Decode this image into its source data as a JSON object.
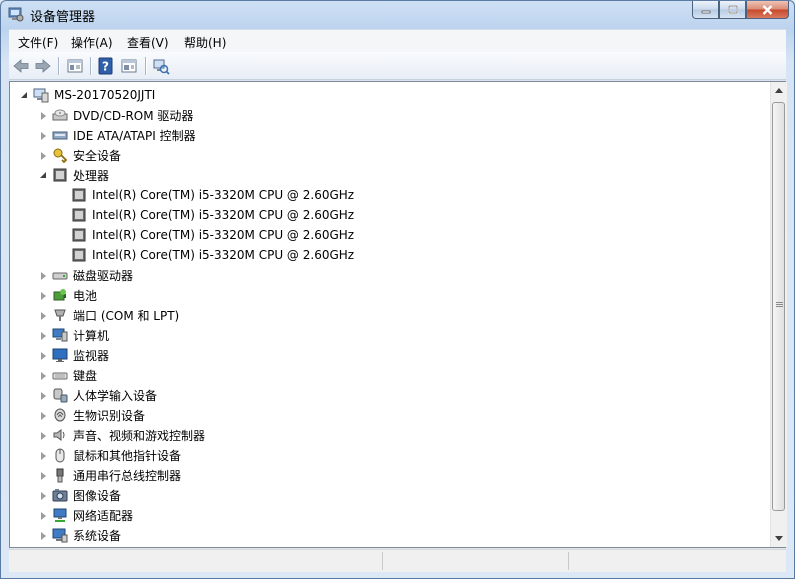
{
  "window": {
    "title": "设备管理器"
  },
  "menu": {
    "items": [
      "文件(F)",
      "操作(A)",
      "查看(V)",
      "帮助(H)"
    ]
  },
  "toolbar": {
    "buttons": [
      "back-icon",
      "forward-icon",
      "properties-icon",
      "help-icon",
      "details-view-icon",
      "scan-hardware-icon"
    ]
  },
  "tree": {
    "root": "MS-20170520JJTI",
    "categories": [
      {
        "label": "DVD/CD-ROM 驱动器",
        "icon": "dvd-drive-icon"
      },
      {
        "label": "IDE ATA/ATAPI 控制器",
        "icon": "ide-controller-icon"
      },
      {
        "label": "安全设备",
        "icon": "security-device-icon"
      },
      {
        "label": "处理器",
        "icon": "processor-icon",
        "expanded": true,
        "children": [
          "Intel(R) Core(TM) i5-3320M CPU @ 2.60GHz",
          "Intel(R) Core(TM) i5-3320M CPU @ 2.60GHz",
          "Intel(R) Core(TM) i5-3320M CPU @ 2.60GHz",
          "Intel(R) Core(TM) i5-3320M CPU @ 2.60GHz"
        ]
      },
      {
        "label": "磁盘驱动器",
        "icon": "disk-drive-icon"
      },
      {
        "label": "电池",
        "icon": "battery-icon"
      },
      {
        "label": "端口 (COM 和 LPT)",
        "icon": "port-icon"
      },
      {
        "label": "计算机",
        "icon": "computer-icon"
      },
      {
        "label": "监视器",
        "icon": "monitor-icon"
      },
      {
        "label": "键盘",
        "icon": "keyboard-icon"
      },
      {
        "label": "人体学输入设备",
        "icon": "hid-icon"
      },
      {
        "label": "生物识别设备",
        "icon": "biometric-icon"
      },
      {
        "label": "声音、视频和游戏控制器",
        "icon": "sound-icon"
      },
      {
        "label": "鼠标和其他指针设备",
        "icon": "mouse-icon"
      },
      {
        "label": "通用串行总线控制器",
        "icon": "usb-icon"
      },
      {
        "label": "图像设备",
        "icon": "imaging-device-icon"
      },
      {
        "label": "网络适配器",
        "icon": "network-adapter-icon"
      },
      {
        "label": "系统设备",
        "icon": "system-device-icon"
      }
    ]
  },
  "colors": {
    "titlebar": "#bcd3ee",
    "selection": "#cce8ff",
    "close_button": "#c7472a"
  }
}
